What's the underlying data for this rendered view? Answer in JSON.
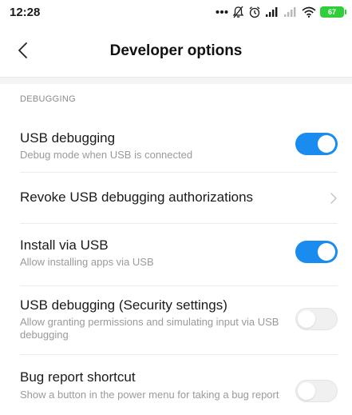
{
  "status_bar": {
    "time": "12:28",
    "battery_level": "67",
    "icons": [
      "more-dots-icon",
      "notifications-off-icon",
      "alarm-icon",
      "cellular-signal-icon",
      "cellular-signal-weak-icon",
      "wifi-icon",
      "battery-icon"
    ]
  },
  "header": {
    "title": "Developer options",
    "back_icon": "chevron-left-icon"
  },
  "section": {
    "label": "DEBUGGING"
  },
  "settings": [
    {
      "title": "USB debugging",
      "subtitle": "Debug mode when USB is connected",
      "control": "toggle",
      "enabled": true
    },
    {
      "title": "Revoke USB debugging authorizations",
      "subtitle": "",
      "control": "chevron",
      "enabled": null
    },
    {
      "title": "Install via USB",
      "subtitle": "Allow installing apps via USB",
      "control": "toggle",
      "enabled": true
    },
    {
      "title": "USB debugging (Security settings)",
      "subtitle": "Allow granting permissions and simulating input via USB debugging",
      "control": "toggle",
      "enabled": false
    },
    {
      "title": "Bug report shortcut",
      "subtitle": "Show a button in the power menu for taking a bug report",
      "control": "toggle",
      "enabled": false
    }
  ],
  "colors": {
    "toggle_on": "#1a8cf0",
    "toggle_off": "#f0f0f0",
    "battery": "#2fce3a"
  }
}
